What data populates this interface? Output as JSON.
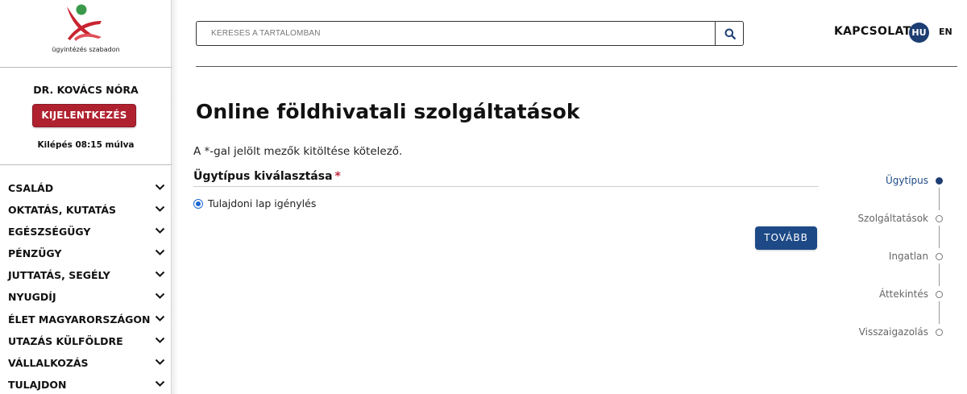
{
  "logo": {
    "caption": "ügyintézés szabadon"
  },
  "user": {
    "name": "DR. KOVÁCS NÓRA",
    "logout_label": "KIJELENTKEZÉS",
    "timer_text": "Kilépés 08:15 múlva"
  },
  "nav": {
    "items": [
      {
        "label": "CSALÁD"
      },
      {
        "label": "OKTATÁS, KUTATÁS"
      },
      {
        "label": "EGÉSZSÉGÜGY"
      },
      {
        "label": "PÉNZÜGY"
      },
      {
        "label": "JUTTATÁS, SEGÉLY"
      },
      {
        "label": "NYUGDÍJ"
      },
      {
        "label": "ÉLET MAGYARORSZÁGON"
      },
      {
        "label": "UTAZÁS KÜLFÖLDRE"
      },
      {
        "label": "VÁLLALKOZÁS"
      },
      {
        "label": "TULAJDON"
      }
    ]
  },
  "header": {
    "search_placeholder": "KERESÉS A TARTALOMBAN",
    "contact_label": "KAPCSOLAT",
    "lang_active": "HU",
    "lang_other": "EN"
  },
  "main": {
    "title": "Online földhivatali szolgáltatások",
    "required_note": "A *-gal jelölt mezők kitöltése kötelező.",
    "section_label": "Ügytípus kiválasztása",
    "required_mark": "*",
    "radio_option": "Tulajdoni lap igénylés",
    "next_label": "TOVÁBB"
  },
  "stepper": {
    "steps": [
      {
        "label": "Ügytípus",
        "active": true
      },
      {
        "label": "Szolgáltatások",
        "active": false
      },
      {
        "label": "Ingatlan",
        "active": false
      },
      {
        "label": "Áttekintés",
        "active": false
      },
      {
        "label": "Visszaigazolás",
        "active": false
      }
    ]
  },
  "colors": {
    "brand_red": "#b0212f",
    "brand_blue": "#1d4a86",
    "logo_green": "#3a9a4a"
  }
}
